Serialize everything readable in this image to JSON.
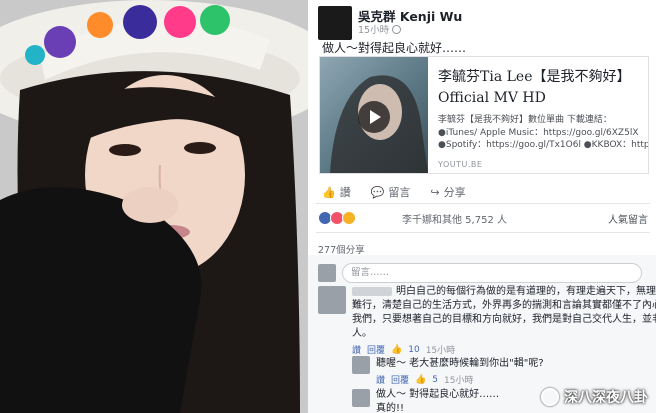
{
  "post": {
    "author": "吳克群 Kenji Wu",
    "time": "15小時",
    "text": "做人～對得起良心就好……",
    "link": {
      "title": "李毓芬Tia Lee【是我不夠好】Official MV HD",
      "desc_lines": [
        "李毓芬【是我不夠好】數位單曲 下載連結：",
        "●iTunes/ Apple Music：https://goo.gl/6XZ5lX",
        "●Spotify：https://goo.gl/Tx1O6l ●KKBOX：https://"
      ],
      "domain": "YOUTU.BE"
    },
    "actions": {
      "like": "讚",
      "comment": "留言",
      "share": "分享"
    },
    "reactions": {
      "reactors": "李千娜和其他 5,752 人",
      "sort": "人氣留言"
    },
    "shares": "277個分享",
    "comment_placeholder": "留言……"
  },
  "comments": [
    {
      "lines": [
        "明白自己的每個行為做的是有道理的，有理走遍天下，無理寸步",
        "難行，清楚自己的生活方式，外界再多的揣測和言論其實都僅不了內心的",
        "我們，只要想著自己的目標和方向就好，我們是對自己交代人生，並非別",
        "人。"
      ],
      "like": "讚",
      "reply": "回覆",
      "likes": "10",
      "time": "15小時"
    },
    {
      "lines": [
        "聽喔～ 老大甚麼時候輪到你出\"輯\"呢?"
      ],
      "like": "讚",
      "reply": "回覆",
      "likes": "5",
      "time": "15小時"
    },
    {
      "lines": [
        "做人～ 對得起良心就好……",
        "真的!!"
      ]
    }
  ],
  "watermark": "深八深夜八卦"
}
